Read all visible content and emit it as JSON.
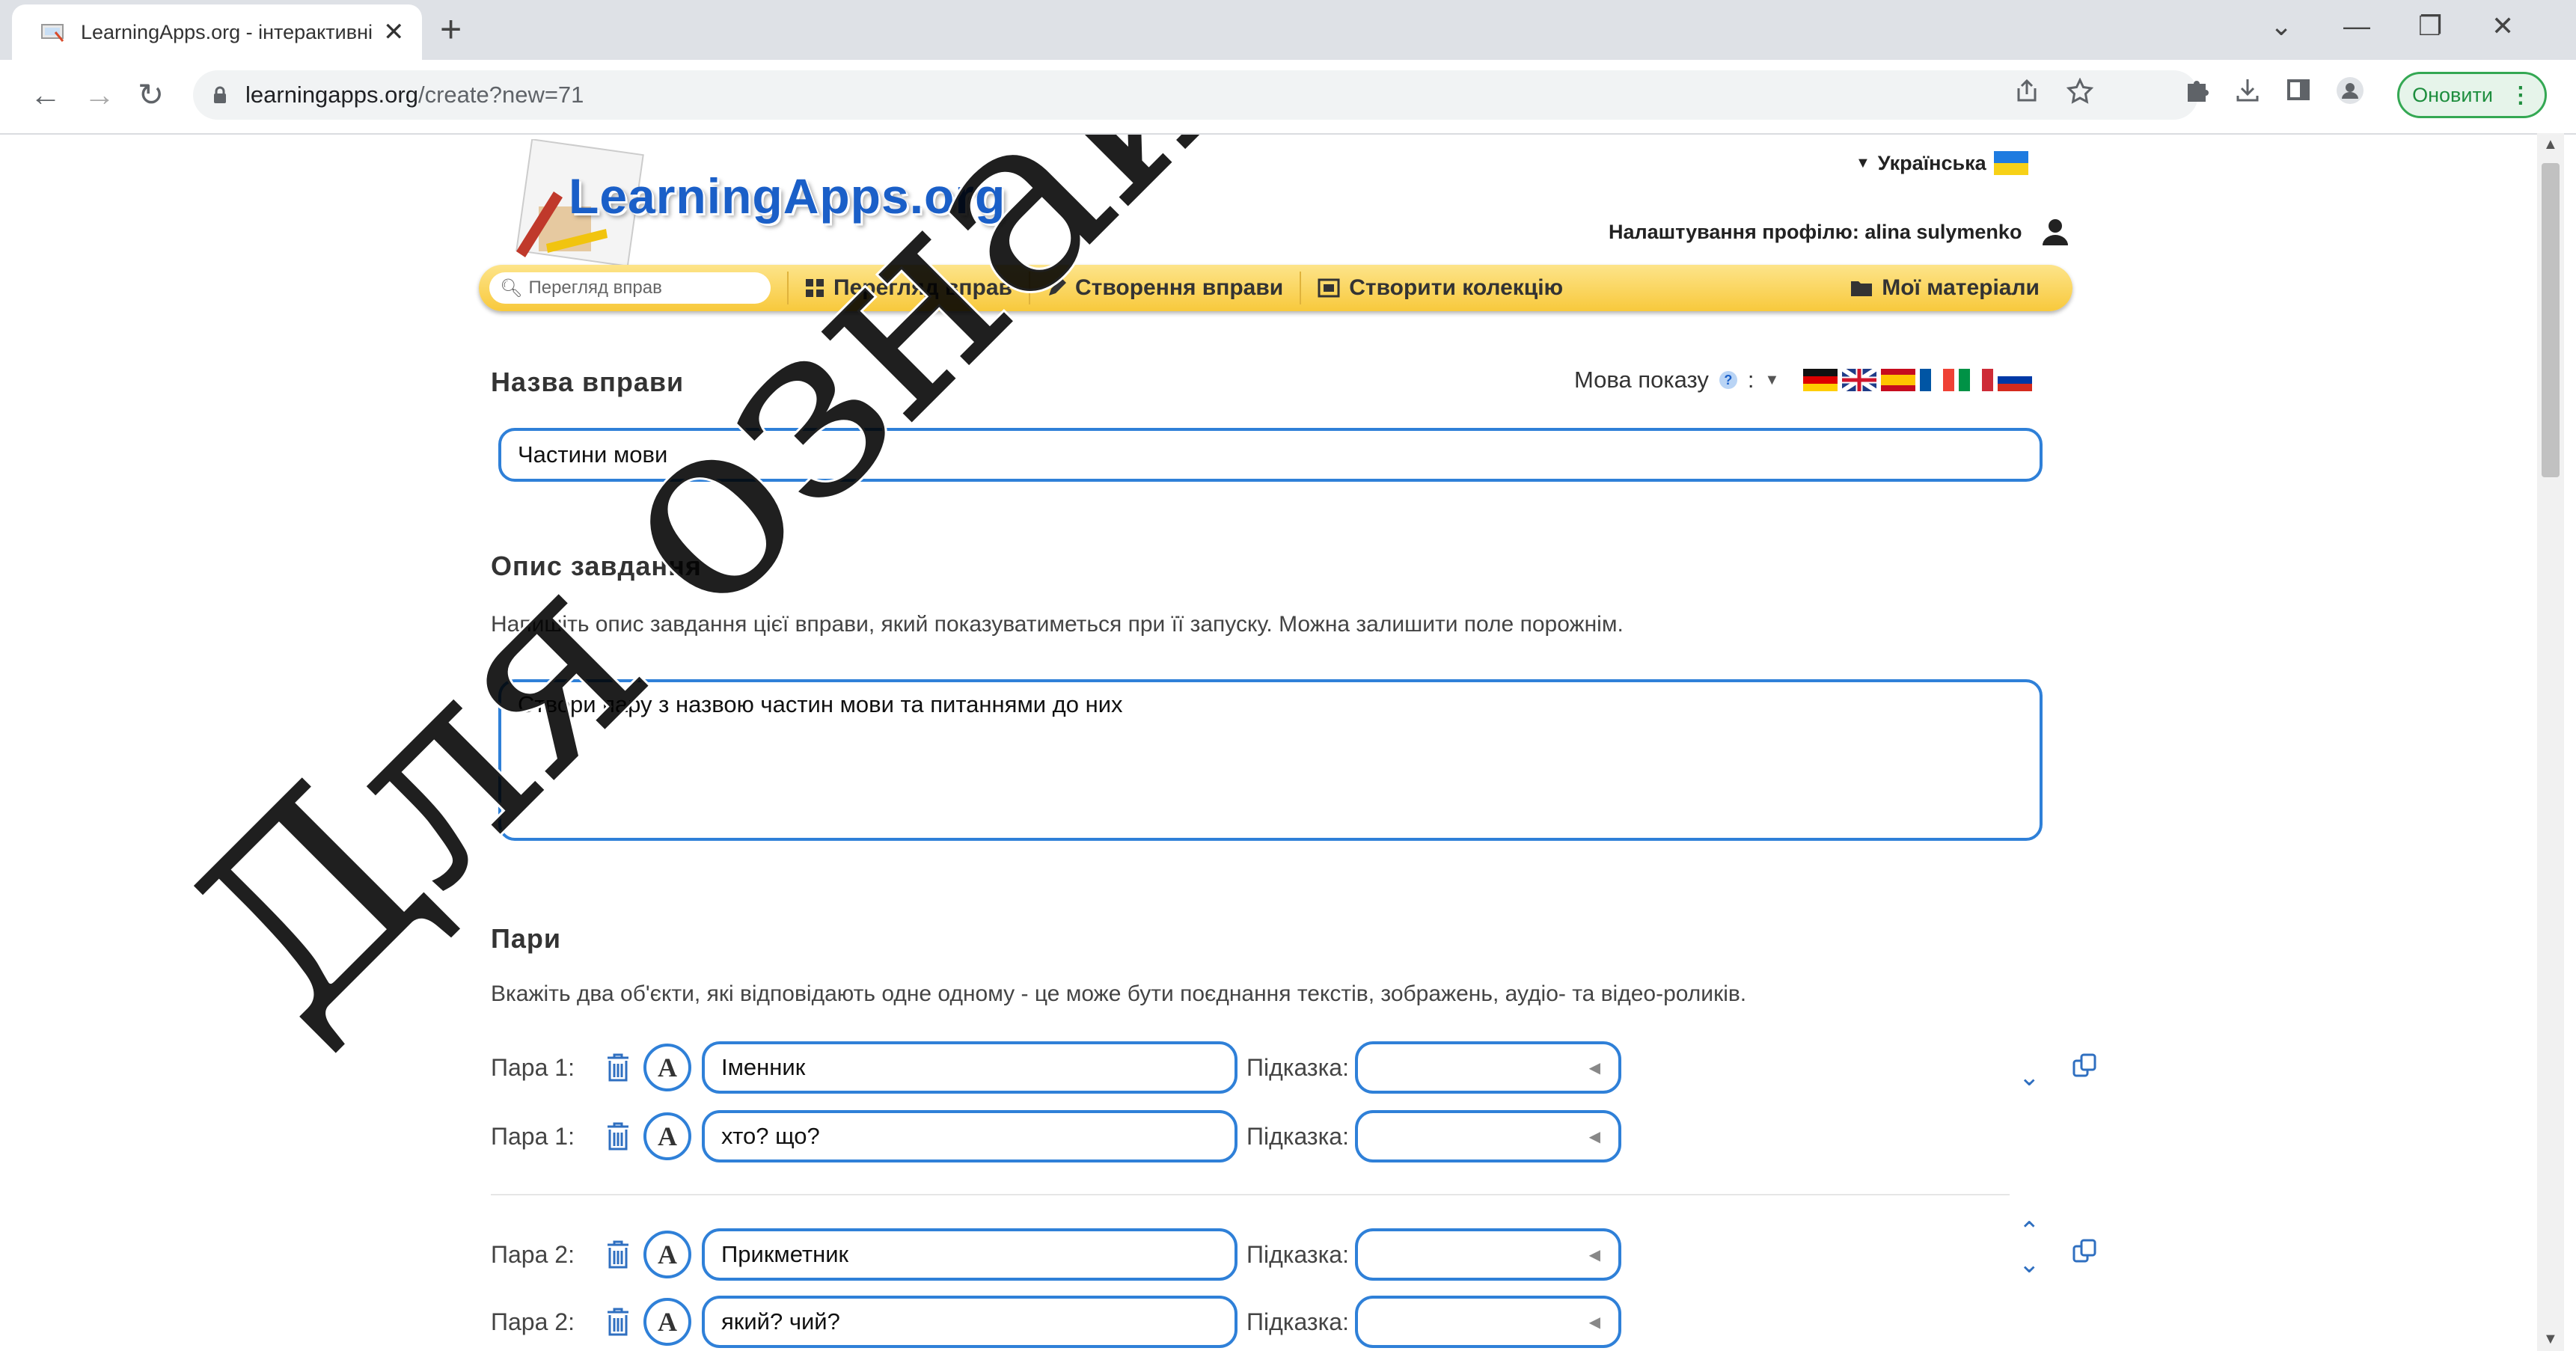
{
  "browser": {
    "tab_title": "LearningApps.org - інтерактивні",
    "tab_close": "✕",
    "new_tab": "+",
    "url_host": "learningapps.org",
    "url_path": "/create?new=71",
    "update_label": "Оновити",
    "update_dots": "⋮",
    "back": "←",
    "forward": "→",
    "reload": "↻",
    "minimize": "—",
    "restore": "❐",
    "close_window": "✕",
    "tab_list": "⌄"
  },
  "site": {
    "logo": "LearningApps.org",
    "language": "Українська",
    "profile": "Налаштування профілю: alina sulymenko",
    "search_placeholder": "Перегляд вправ",
    "menu": {
      "browse": "Перегляд вправ",
      "create": "Створення вправи",
      "collection": "Створити колекцію",
      "my_materials": "Мої матеріали"
    }
  },
  "form": {
    "title_heading": "Назва вправи",
    "display_language_label": "Мова показу",
    "help": "?",
    "colon": ":",
    "title_value": "Частини мови",
    "description_heading": "Опис завдання",
    "description_hint": "Напишіть опис завдання цієї вправи, який показуватиметься при її запуску. Можна залишити поле порожнім.",
    "description_value": "Створи пару з назвою частин мови та питаннями до них",
    "pairs_heading": "Пари",
    "pairs_hint": "Вкажіть два об'єкти, які відповідають одне одному - це може бути поєднання текстів, зображень, аудіо- та відео-роликів.",
    "hint_label": "Підказка:",
    "font_glyph": "A",
    "pairs": [
      {
        "label": "Пара 1:",
        "value": "Іменник"
      },
      {
        "label": "Пара 1:",
        "value": "хто? що?"
      },
      {
        "label": "Пара 2:",
        "value": "Прикметник"
      },
      {
        "label": "Пара 2:",
        "value": "який? чий?"
      }
    ]
  },
  "watermark": "Для ознайомлення",
  "colors": {
    "accent": "#2f80d8",
    "menubar": "#f8c93c",
    "update_green": "#1e8e3e"
  }
}
